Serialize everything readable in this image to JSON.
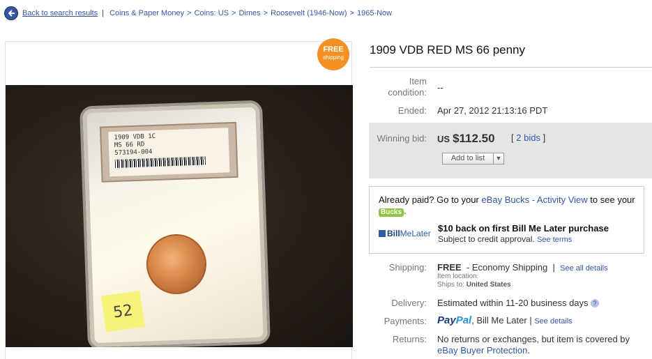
{
  "nav": {
    "back_label": "Back to search results",
    "separator": "|",
    "breadcrumbs": [
      "Coins & Paper Money",
      "Coins: US",
      "Dimes",
      "Roosevelt (1946-Now)",
      "1965-Now"
    ]
  },
  "image": {
    "badge_top": "FREE",
    "badge_bottom": "shipping",
    "slab_line1": "1909 VDB  1C",
    "slab_line2": "MS 66 RD",
    "slab_line3": "573194-004",
    "sticky_note": "52"
  },
  "listing": {
    "title": "1909 VDB RED MS 66 penny",
    "condition_label": "Item condition:",
    "condition_value": "--",
    "ended_label": "Ended:",
    "ended_value": "Apr 27, 2012 21:13:16 PDT",
    "winning_bid_label": "Winning bid:",
    "currency": "US",
    "amount": "$112.50",
    "bids_open": "[",
    "bids_link": "2 bids",
    "bids_close": "]",
    "add_to_list": "Add to list"
  },
  "promo": {
    "already_paid": "Already paid?",
    "goto_text": "Go to your",
    "ebay_bucks_link": "eBay Bucks - Activity View",
    "to_see": "to see your",
    "bucks_badge": "Bucks",
    "period": ".",
    "bml_logo_a": "Bill",
    "bml_logo_b": "MeLater",
    "bml_headline": "$10 back on first Bill Me Later purchase",
    "bml_sub": "Subject to credit approval.",
    "see_terms": "See terms"
  },
  "shipping": {
    "label": "Shipping:",
    "free": "FREE",
    "method": "- Economy Shipping",
    "sep": "|",
    "see_all": "See all details",
    "item_location_label": "Item location:",
    "ships_to_label": "Ships to:",
    "ships_to_value": "United States"
  },
  "delivery": {
    "label": "Delivery:",
    "value": "Estimated within 11-20 business days",
    "help_icon": "?"
  },
  "payments": {
    "label": "Payments:",
    "paypal_a": "Pay",
    "paypal_b": "Pal",
    "bml": ", Bill Me Later",
    "sep": "|",
    "see_details": "See details"
  },
  "returns": {
    "label": "Returns:",
    "value": "No returns or exchanges, but item is covered by",
    "protection_link": "eBay Buyer Protection",
    "period": "."
  }
}
